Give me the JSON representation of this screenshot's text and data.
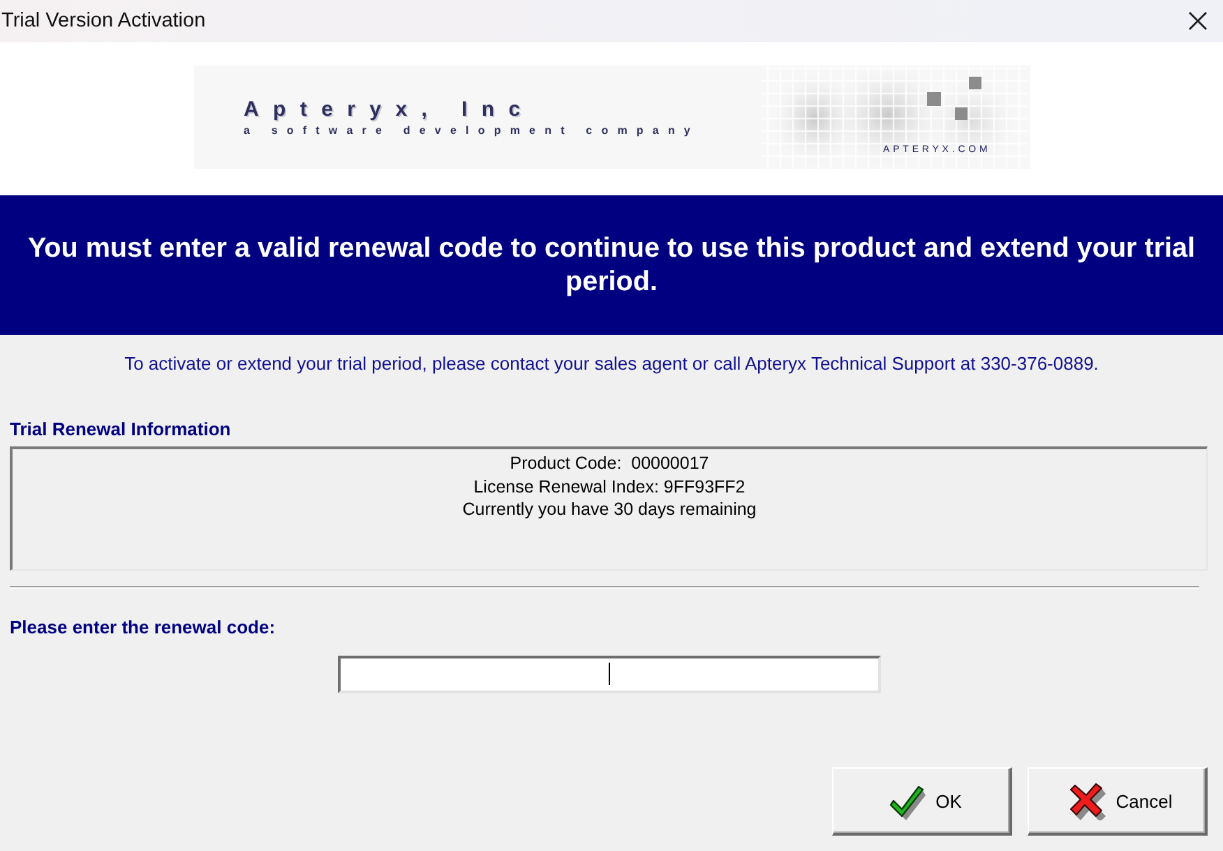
{
  "window": {
    "title": "Trial Version Activation"
  },
  "banner": {
    "company": "Apteryx, Inc",
    "tagline": "a software development company",
    "website": "APTERYX.COM"
  },
  "notice": "You must enter a valid renewal code to continue to use this product and extend your trial period.",
  "contact_info": "To activate or extend your trial period, please contact your sales agent or call Apteryx Technical Support at 330-376-0889.",
  "renewal_info": {
    "heading": "Trial Renewal Information",
    "lines": [
      "Product Code:  00000017",
      "License Renewal Index: 9FF93FF2",
      "Currently you have 30 days remaining"
    ]
  },
  "renewal_code": {
    "label": "Please enter the renewal code:",
    "focused": true
  },
  "buttons": [
    {
      "label": "OK",
      "kind": "ok"
    },
    {
      "label": "Cancel",
      "kind": "cancel"
    }
  ]
}
